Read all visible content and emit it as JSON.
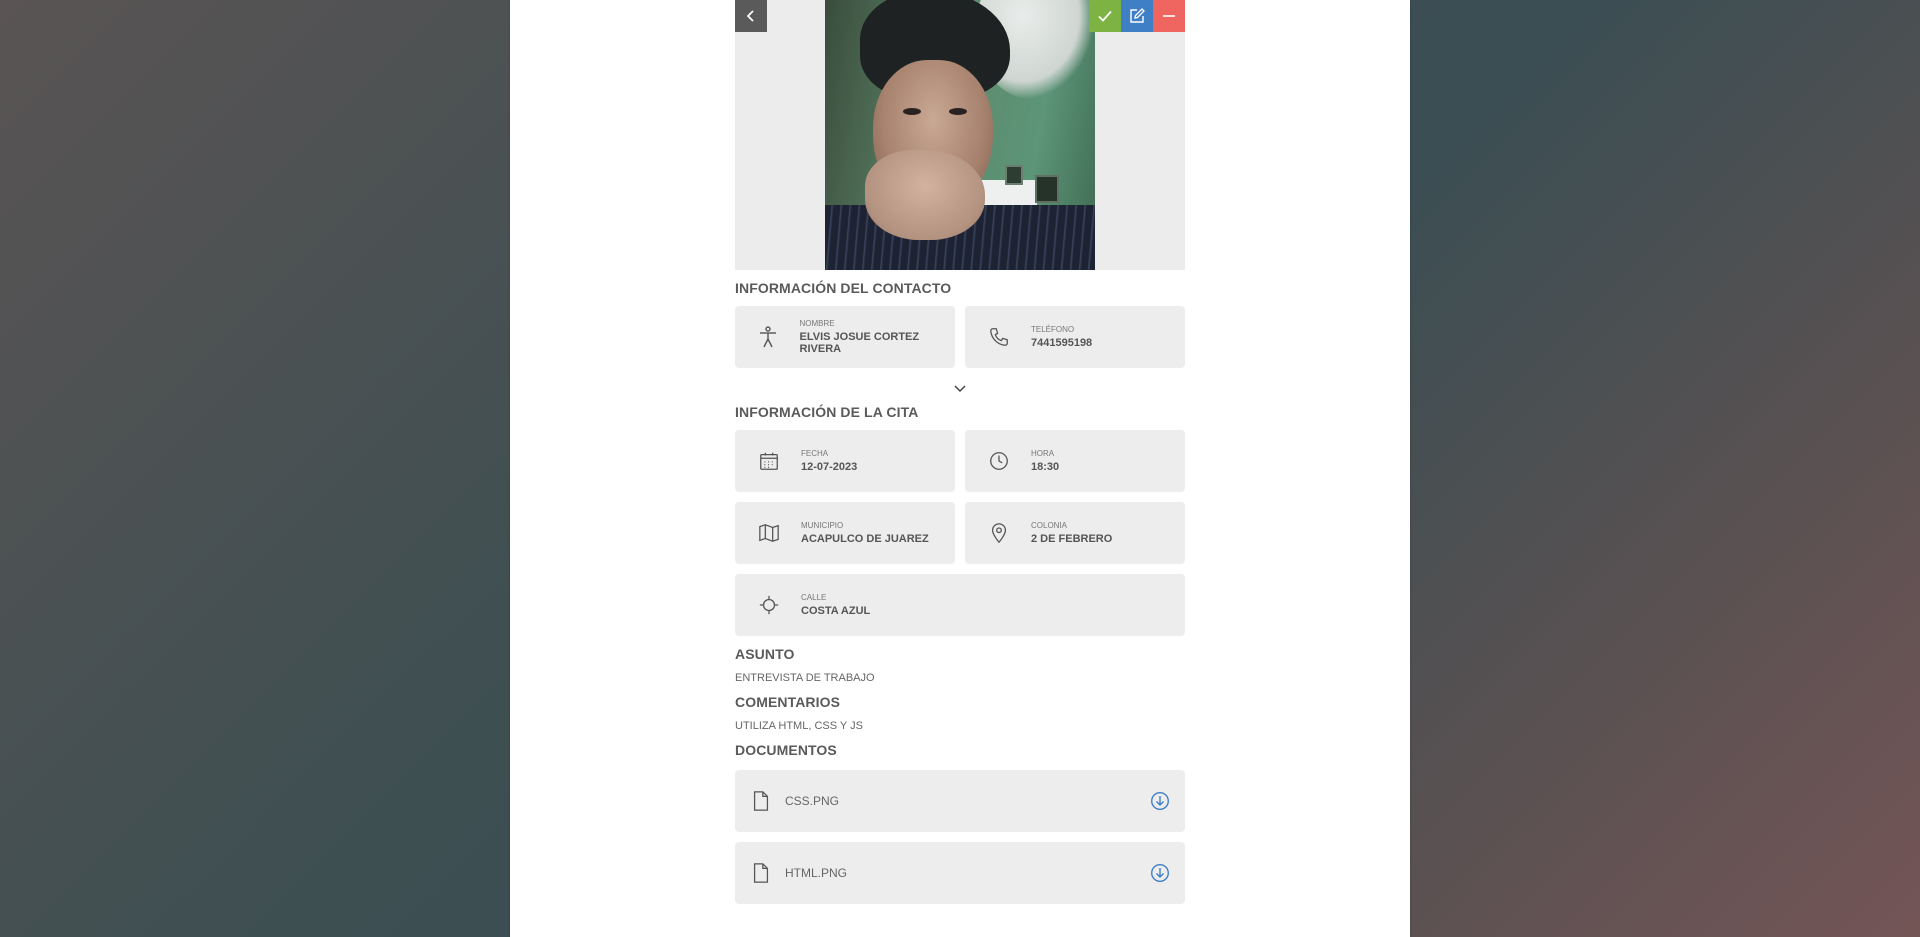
{
  "colors": {
    "accept": "#7cb342",
    "edit": "#3f7fc6",
    "delete": "#ef6560",
    "back": "#5a5a5a",
    "card": "#ededed"
  },
  "contact": {
    "title": "INFORMACIÓN DEL CONTACTO",
    "nombre_label": "NOMBRE",
    "nombre": "ELVIS JOSUE CORTEZ RIVERA",
    "telefono_label": "TELÉFONO",
    "telefono": "7441595198"
  },
  "cita": {
    "title": "INFORMACIÓN DE LA CITA",
    "fecha_label": "FECHA",
    "fecha": "12-07-2023",
    "hora_label": "HORA",
    "hora": "18:30",
    "municipio_label": "MUNICIPIO",
    "municipio": "ACAPULCO DE JUAREZ",
    "colonia_label": "COLONIA",
    "colonia": "2 DE FEBRERO",
    "calle_label": "CALLE",
    "calle": "COSTA AZUL"
  },
  "asunto": {
    "title": "ASUNTO",
    "text": "ENTREVISTA DE TRABAJO"
  },
  "comentarios": {
    "title": "COMENTARIOS",
    "text": "UTILIZA HTML, CSS Y JS"
  },
  "documentos": {
    "title": "DOCUMENTOS",
    "files": [
      "CSS.PNG",
      "HTML.PNG"
    ]
  },
  "icons": {
    "back": "chevron-left-icon",
    "accept": "check-icon",
    "edit": "edit-icon",
    "delete": "minus-icon",
    "nombre": "person-icon",
    "telefono": "phone-icon",
    "expand": "chevron-down-icon",
    "fecha": "calendar-icon",
    "hora": "clock-icon",
    "municipio": "map-icon",
    "colonia": "location-pin-icon",
    "calle": "crosshair-icon",
    "document": "file-icon",
    "download": "download-icon"
  }
}
